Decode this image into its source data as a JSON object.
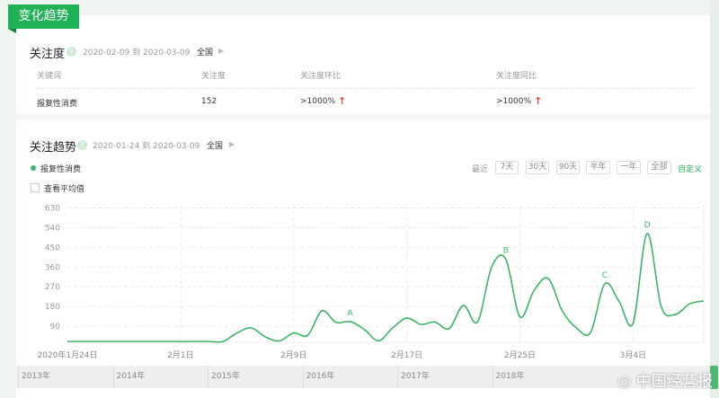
{
  "section_tag": "变化趋势",
  "attention": {
    "title": "关注度",
    "help": "?",
    "date_range": "2020-02-09 到 2020-03-09",
    "region": "全国",
    "headers": [
      "关键词",
      "关注度",
      "关注度环比",
      "关注度同比"
    ],
    "row": {
      "keyword": "报复性消费",
      "value": "152",
      "mom": ">1000%",
      "yoy": ">1000%"
    }
  },
  "trend": {
    "title": "关注趋势",
    "help": "?",
    "date_range": "2020-01-24 到 2020-03-09",
    "region": "全国",
    "legend": "报复性消费",
    "show_average": "查看平均值",
    "recent_label": "最近",
    "ranges": [
      "7天",
      "30天",
      "90天",
      "半年",
      "一年",
      "全部"
    ],
    "custom": "自定义"
  },
  "timeline": [
    "2013年",
    "2014年",
    "2015年",
    "2016年",
    "2017年",
    "2018年"
  ],
  "watermark": "中国经营报",
  "colors": {
    "accent": "#1fb257",
    "line": "#3db467",
    "up": "#e84c3d"
  },
  "chart_data": {
    "type": "line",
    "title": "",
    "x_start": "2020-01-24",
    "x_end": "2020-03-09",
    "x_tick_labels": [
      "2020年1月24日",
      "2月1日",
      "2月9日",
      "2月17日",
      "2月25日",
      "3月4日"
    ],
    "x_tick_index": [
      0,
      8,
      16,
      24,
      32,
      40
    ],
    "y_ticks": [
      90,
      180,
      270,
      360,
      450,
      540,
      630
    ],
    "ylim": [
      0,
      630
    ],
    "grid": true,
    "series": [
      {
        "name": "报复性消费",
        "values": [
          20,
          20,
          20,
          20,
          20,
          20,
          20,
          20,
          20,
          20,
          20,
          20,
          59,
          82,
          41,
          23,
          59,
          49,
          160,
          107,
          111,
          75,
          23,
          82,
          127,
          98,
          109,
          79,
          185,
          109,
          360,
          397,
          133,
          253,
          308,
          160,
          82,
          62,
          283,
          205,
          103,
          513,
          178,
          144,
          192,
          205
        ]
      }
    ],
    "annotations": [
      {
        "label": "A",
        "index": 20
      },
      {
        "label": "B",
        "index": 31
      },
      {
        "label": "C",
        "index": 38
      },
      {
        "label": "D",
        "index": 41
      }
    ]
  }
}
